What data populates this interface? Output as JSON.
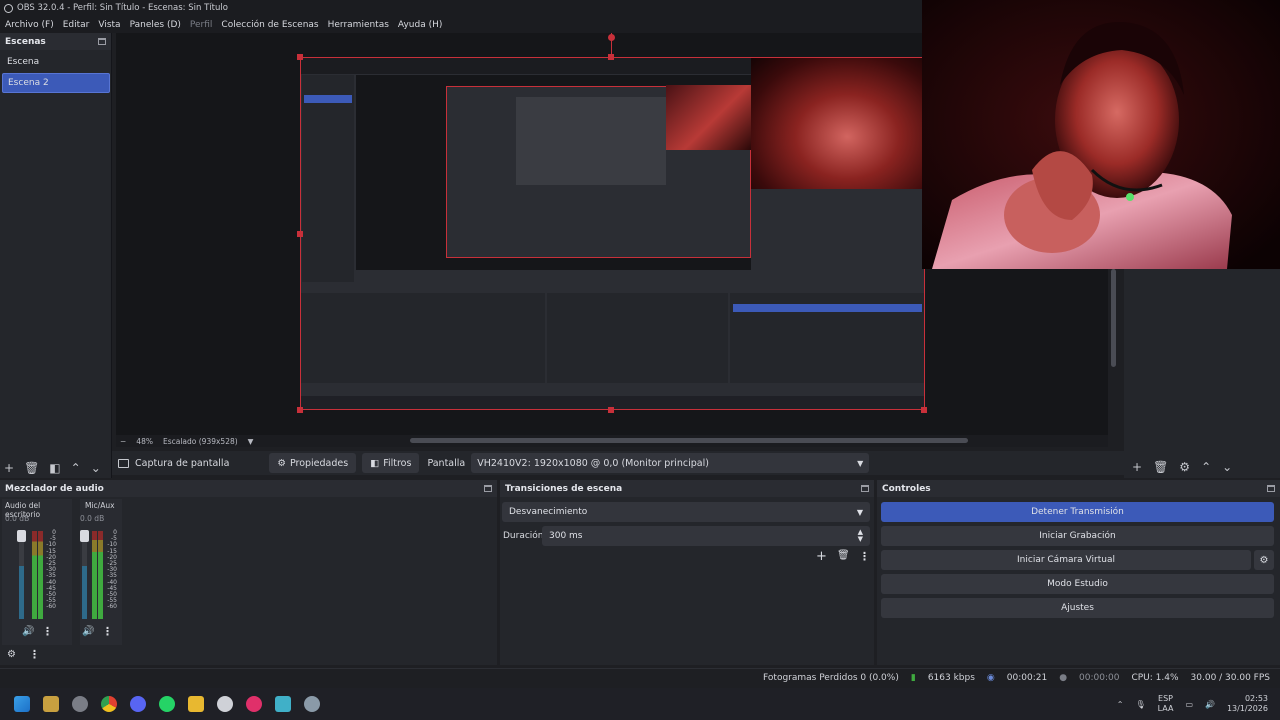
{
  "window": {
    "title": "OBS 32.0.4 - Perfil: Sin Título - Escenas: Sin Título"
  },
  "menu": {
    "archivo": "Archivo (F)",
    "editar": "Editar",
    "vista": "Vista",
    "paneles": "Paneles (D)",
    "perfil": "Perfil",
    "coleccion": "Colección de Escenas",
    "herramientas": "Herramientas",
    "ayuda": "Ayuda (H)"
  },
  "scenes": {
    "title": "Escenas",
    "items": [
      {
        "label": "Escena"
      },
      {
        "label": "Escena 2"
      }
    ]
  },
  "preview": {
    "zoom": "48%",
    "scale": "Escalado (939x528)"
  },
  "source_toolbar": {
    "source": "Captura de pantalla",
    "properties": "Propiedades",
    "filters": "Filtros",
    "display_label": "Pantalla",
    "display_value": "VH2410V2: 1920x1080 @ 0,0 (Monitor principal)"
  },
  "mixer": {
    "title": "Mezclador de audio",
    "channels": [
      {
        "name": "Audio del escritorio",
        "db": "0.0 dB"
      },
      {
        "name": "Mic/Aux",
        "db": "0.0 dB"
      }
    ],
    "ticks": [
      "0",
      "-5",
      "-10",
      "-15",
      "-20",
      "-25",
      "-30",
      "-35",
      "-40",
      "-45",
      "-50",
      "-55",
      "-60"
    ]
  },
  "transitions": {
    "title": "Transiciones de escena",
    "type": "Desvanecimiento",
    "duration_label": "Duración",
    "duration_value": "300 ms"
  },
  "controls": {
    "title": "Controles",
    "stop_stream": "Detener Transmisión",
    "start_record": "Iniciar Grabación",
    "virtual_cam": "Iniciar Cámara Virtual",
    "studio_mode": "Modo Estudio",
    "settings": "Ajustes"
  },
  "status": {
    "dropped": "Fotogramas Perdidos 0 (0.0%)",
    "bitrate": "6163 kbps",
    "stream_time": "00:00:21",
    "rec_time": "00:00:00",
    "cpu": "CPU: 1.4%",
    "fps": "30.00 / 30.00 FPS"
  },
  "taskbar": {
    "lang": "ESP",
    "lang2": "LAA",
    "time": "02:53",
    "date": "13/1/2026"
  },
  "colors": {
    "accent": "#3c5ab8",
    "selection_red": "#c8303a",
    "meter_green": "#3faa3f"
  }
}
